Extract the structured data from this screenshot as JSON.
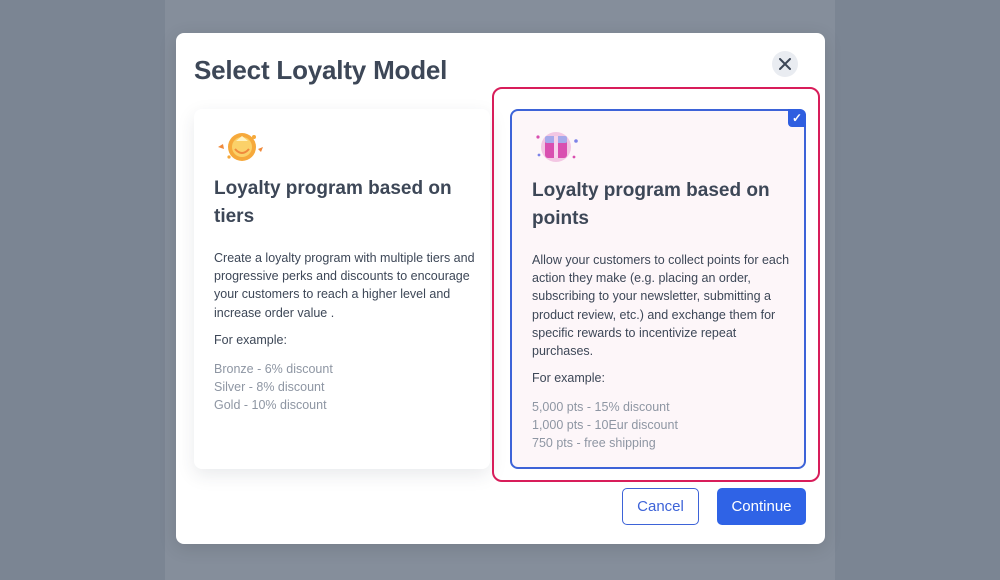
{
  "modal": {
    "title": "Select Loyalty Model",
    "close_icon": "close-icon"
  },
  "cards": [
    {
      "id": "tiers",
      "icon": "tiers-medal-icon",
      "title": "Loyalty program based on tiers",
      "description": "Create a loyalty program with multiple tiers and progressive perks and discounts to encourage your customers to reach a higher level and increase order value .",
      "example_label": "For example:",
      "examples": [
        "Bronze - 6% discount",
        "Silver - 8% discount",
        "Gold - 10% discount"
      ],
      "selected": false
    },
    {
      "id": "points",
      "icon": "points-gift-icon",
      "title": "Loyalty program based on points",
      "description": "Allow your customers to collect points for each action they make (e.g. placing an order, subscribing to your newsletter, submitting a product review, etc.) and exchange them for specific rewards to incentivize repeat purchases.",
      "example_label": "For example:",
      "examples": [
        "5,000 pts - 15% discount",
        "1,000 pts - 10Eur discount",
        "750 pts - free shipping"
      ],
      "selected": true,
      "check_mark": "✓"
    }
  ],
  "footer": {
    "cancel_label": "Cancel",
    "continue_label": "Continue"
  },
  "colors": {
    "accent": "#2f63e6",
    "selection_ring": "#d81d5a",
    "text_primary": "#3d4757",
    "text_muted": "#8e96a3"
  }
}
